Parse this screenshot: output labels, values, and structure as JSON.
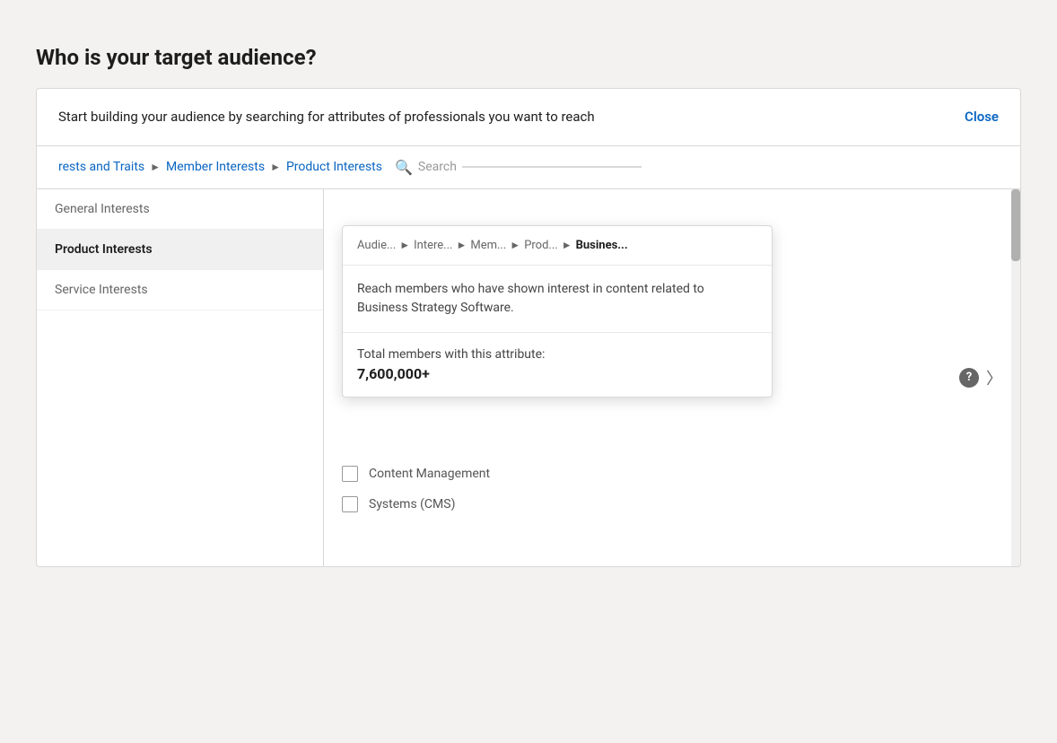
{
  "page": {
    "title": "Who is your target audience?"
  },
  "card": {
    "header": {
      "description": "Start building your audience by searching for attributes of professionals you want to reach",
      "close_label": "Close"
    },
    "breadcrumb": {
      "items": [
        {
          "label": "rests and Traits",
          "truncated": true
        },
        {
          "label": "Member Interests"
        },
        {
          "label": "Product Interests"
        }
      ],
      "search_placeholder": "Search"
    },
    "sidebar": {
      "items": [
        {
          "label": "General Interests",
          "active": false
        },
        {
          "label": "Product Interests",
          "active": true
        },
        {
          "label": "Service Interests",
          "active": false
        }
      ]
    },
    "tooltip": {
      "breadcrumb": [
        {
          "label": "Audie..."
        },
        {
          "label": "Intere..."
        },
        {
          "label": "Mem..."
        },
        {
          "label": "Prod..."
        },
        {
          "label": "Busines...",
          "bold": true
        }
      ],
      "description": "Reach members who have shown interest in content related to Business Strategy Software.",
      "stats_label": "Total members with this attribute:",
      "stats_count": "7,600,000+"
    },
    "right_items": [
      {
        "label": "Content Management"
      },
      {
        "label": "Systems (CMS)"
      }
    ]
  }
}
